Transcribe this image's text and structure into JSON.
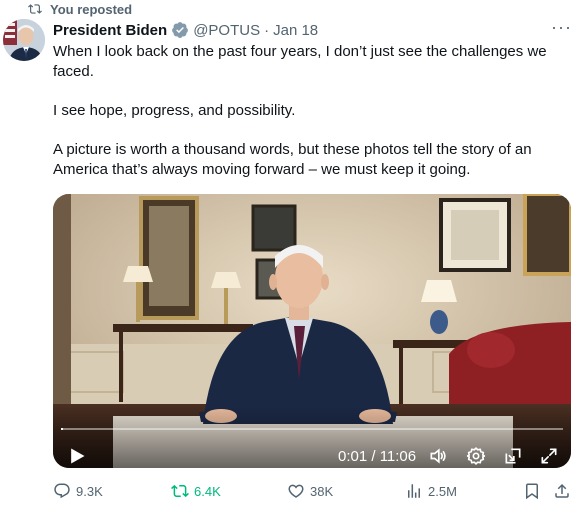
{
  "repost_label": "You reposted",
  "author": {
    "name": "President Biden",
    "handle": "@POTUS",
    "separator": "·",
    "date": "Jan 18"
  },
  "more_label": "···",
  "text": {
    "p1": "When I look back on the past four years, I don’t just see the challenges we faced.",
    "p2": "I see hope, progress, and possibility.",
    "p3": "A picture is worth a thousand words, but these photos tell the story of an America that’s always moving forward – we must keep it going."
  },
  "video": {
    "time": "0:01 / 11:06",
    "progress": 0.0015
  },
  "actions": {
    "replies": "9.3K",
    "reposts": "6.4K",
    "likes": "38K",
    "views": "2.5M"
  },
  "colors": {
    "repost_active": "#00ba7c",
    "muted": "#536471",
    "verified_badge": "#829aab"
  }
}
